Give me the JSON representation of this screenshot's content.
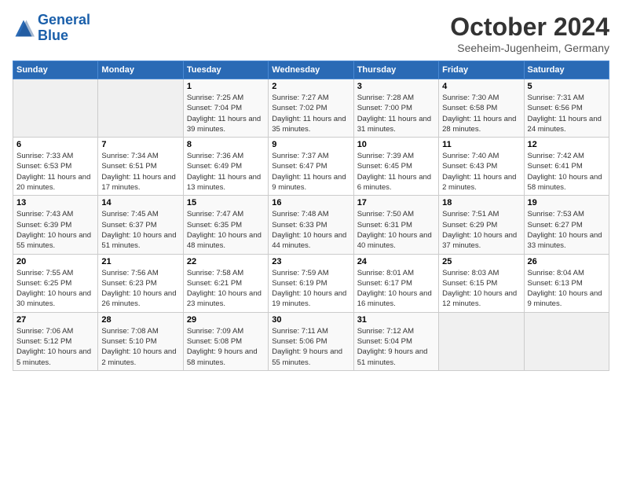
{
  "header": {
    "logo_line1": "General",
    "logo_line2": "Blue",
    "month": "October 2024",
    "location": "Seeheim-Jugenheim, Germany"
  },
  "weekdays": [
    "Sunday",
    "Monday",
    "Tuesday",
    "Wednesday",
    "Thursday",
    "Friday",
    "Saturday"
  ],
  "weeks": [
    [
      {
        "day": "",
        "empty": true
      },
      {
        "day": "",
        "empty": true
      },
      {
        "day": "1",
        "sunrise": "Sunrise: 7:25 AM",
        "sunset": "Sunset: 7:04 PM",
        "daylight": "Daylight: 11 hours and 39 minutes."
      },
      {
        "day": "2",
        "sunrise": "Sunrise: 7:27 AM",
        "sunset": "Sunset: 7:02 PM",
        "daylight": "Daylight: 11 hours and 35 minutes."
      },
      {
        "day": "3",
        "sunrise": "Sunrise: 7:28 AM",
        "sunset": "Sunset: 7:00 PM",
        "daylight": "Daylight: 11 hours and 31 minutes."
      },
      {
        "day": "4",
        "sunrise": "Sunrise: 7:30 AM",
        "sunset": "Sunset: 6:58 PM",
        "daylight": "Daylight: 11 hours and 28 minutes."
      },
      {
        "day": "5",
        "sunrise": "Sunrise: 7:31 AM",
        "sunset": "Sunset: 6:56 PM",
        "daylight": "Daylight: 11 hours and 24 minutes."
      }
    ],
    [
      {
        "day": "6",
        "sunrise": "Sunrise: 7:33 AM",
        "sunset": "Sunset: 6:53 PM",
        "daylight": "Daylight: 11 hours and 20 minutes."
      },
      {
        "day": "7",
        "sunrise": "Sunrise: 7:34 AM",
        "sunset": "Sunset: 6:51 PM",
        "daylight": "Daylight: 11 hours and 17 minutes."
      },
      {
        "day": "8",
        "sunrise": "Sunrise: 7:36 AM",
        "sunset": "Sunset: 6:49 PM",
        "daylight": "Daylight: 11 hours and 13 minutes."
      },
      {
        "day": "9",
        "sunrise": "Sunrise: 7:37 AM",
        "sunset": "Sunset: 6:47 PM",
        "daylight": "Daylight: 11 hours and 9 minutes."
      },
      {
        "day": "10",
        "sunrise": "Sunrise: 7:39 AM",
        "sunset": "Sunset: 6:45 PM",
        "daylight": "Daylight: 11 hours and 6 minutes."
      },
      {
        "day": "11",
        "sunrise": "Sunrise: 7:40 AM",
        "sunset": "Sunset: 6:43 PM",
        "daylight": "Daylight: 11 hours and 2 minutes."
      },
      {
        "day": "12",
        "sunrise": "Sunrise: 7:42 AM",
        "sunset": "Sunset: 6:41 PM",
        "daylight": "Daylight: 10 hours and 58 minutes."
      }
    ],
    [
      {
        "day": "13",
        "sunrise": "Sunrise: 7:43 AM",
        "sunset": "Sunset: 6:39 PM",
        "daylight": "Daylight: 10 hours and 55 minutes."
      },
      {
        "day": "14",
        "sunrise": "Sunrise: 7:45 AM",
        "sunset": "Sunset: 6:37 PM",
        "daylight": "Daylight: 10 hours and 51 minutes."
      },
      {
        "day": "15",
        "sunrise": "Sunrise: 7:47 AM",
        "sunset": "Sunset: 6:35 PM",
        "daylight": "Daylight: 10 hours and 48 minutes."
      },
      {
        "day": "16",
        "sunrise": "Sunrise: 7:48 AM",
        "sunset": "Sunset: 6:33 PM",
        "daylight": "Daylight: 10 hours and 44 minutes."
      },
      {
        "day": "17",
        "sunrise": "Sunrise: 7:50 AM",
        "sunset": "Sunset: 6:31 PM",
        "daylight": "Daylight: 10 hours and 40 minutes."
      },
      {
        "day": "18",
        "sunrise": "Sunrise: 7:51 AM",
        "sunset": "Sunset: 6:29 PM",
        "daylight": "Daylight: 10 hours and 37 minutes."
      },
      {
        "day": "19",
        "sunrise": "Sunrise: 7:53 AM",
        "sunset": "Sunset: 6:27 PM",
        "daylight": "Daylight: 10 hours and 33 minutes."
      }
    ],
    [
      {
        "day": "20",
        "sunrise": "Sunrise: 7:55 AM",
        "sunset": "Sunset: 6:25 PM",
        "daylight": "Daylight: 10 hours and 30 minutes."
      },
      {
        "day": "21",
        "sunrise": "Sunrise: 7:56 AM",
        "sunset": "Sunset: 6:23 PM",
        "daylight": "Daylight: 10 hours and 26 minutes."
      },
      {
        "day": "22",
        "sunrise": "Sunrise: 7:58 AM",
        "sunset": "Sunset: 6:21 PM",
        "daylight": "Daylight: 10 hours and 23 minutes."
      },
      {
        "day": "23",
        "sunrise": "Sunrise: 7:59 AM",
        "sunset": "Sunset: 6:19 PM",
        "daylight": "Daylight: 10 hours and 19 minutes."
      },
      {
        "day": "24",
        "sunrise": "Sunrise: 8:01 AM",
        "sunset": "Sunset: 6:17 PM",
        "daylight": "Daylight: 10 hours and 16 minutes."
      },
      {
        "day": "25",
        "sunrise": "Sunrise: 8:03 AM",
        "sunset": "Sunset: 6:15 PM",
        "daylight": "Daylight: 10 hours and 12 minutes."
      },
      {
        "day": "26",
        "sunrise": "Sunrise: 8:04 AM",
        "sunset": "Sunset: 6:13 PM",
        "daylight": "Daylight: 10 hours and 9 minutes."
      }
    ],
    [
      {
        "day": "27",
        "sunrise": "Sunrise: 7:06 AM",
        "sunset": "Sunset: 5:12 PM",
        "daylight": "Daylight: 10 hours and 5 minutes."
      },
      {
        "day": "28",
        "sunrise": "Sunrise: 7:08 AM",
        "sunset": "Sunset: 5:10 PM",
        "daylight": "Daylight: 10 hours and 2 minutes."
      },
      {
        "day": "29",
        "sunrise": "Sunrise: 7:09 AM",
        "sunset": "Sunset: 5:08 PM",
        "daylight": "Daylight: 9 hours and 58 minutes."
      },
      {
        "day": "30",
        "sunrise": "Sunrise: 7:11 AM",
        "sunset": "Sunset: 5:06 PM",
        "daylight": "Daylight: 9 hours and 55 minutes."
      },
      {
        "day": "31",
        "sunrise": "Sunrise: 7:12 AM",
        "sunset": "Sunset: 5:04 PM",
        "daylight": "Daylight: 9 hours and 51 minutes."
      },
      {
        "day": "",
        "empty": true
      },
      {
        "day": "",
        "empty": true
      }
    ]
  ]
}
